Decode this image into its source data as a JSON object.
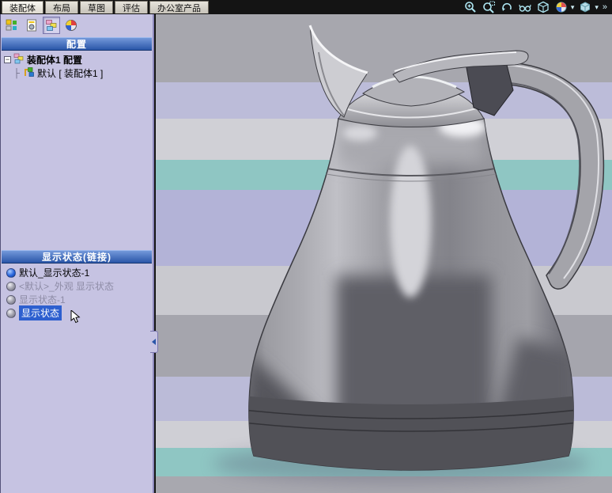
{
  "tabs": [
    {
      "label": "装配体",
      "active": true
    },
    {
      "label": "布局",
      "active": false
    },
    {
      "label": "草图",
      "active": false
    },
    {
      "label": "评估",
      "active": false
    },
    {
      "label": "办公室产品",
      "active": false
    }
  ],
  "hud": {
    "icon_names": [
      "zoom-fit-icon",
      "zoom-area-icon",
      "previous-view-icon",
      "view-settings-icon",
      "view-orientation-icon",
      "appearance-icon",
      "display-style-icon",
      "more-icon"
    ],
    "caret_glyph": "▾",
    "more_glyph": "»"
  },
  "manager_tabs": [
    "feature-manager-icon",
    "property-manager-icon",
    "configuration-manager-icon",
    "display-manager-icon"
  ],
  "panel": {
    "config": {
      "header": "配置",
      "root_label": "装配体1 配置",
      "child_label": "默认 [ 装配体1 ]",
      "expander_glyph": "−",
      "connector_glyph": "├"
    },
    "display": {
      "header": "显示状态(链接)",
      "items": [
        {
          "label": "默认_显示状态-1",
          "state": "active"
        },
        {
          "label": "<默认>_外观 显示状态",
          "state": "dimmed"
        },
        {
          "label": "显示状态-1",
          "state": "dimmed"
        },
        {
          "label": "显示状态",
          "state": "selected"
        }
      ]
    }
  },
  "colors": {
    "header_accent": "#2a56a8",
    "selection_blue": "#2d5fcf",
    "panel_bg": "#c6c3e2",
    "stripe_teal": "#8fc6c3",
    "stripe_lavender": "#b3b3d7",
    "carafe_gray": "#97979d"
  }
}
